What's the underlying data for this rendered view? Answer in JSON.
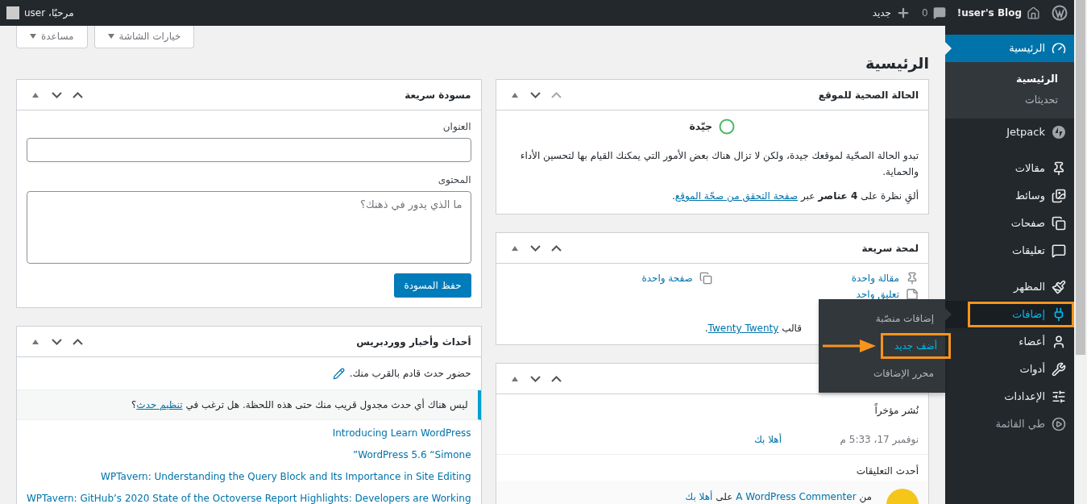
{
  "admin_bar": {
    "site_name": "user's Blog!",
    "comments_count": "0",
    "new_label": "جديد",
    "greeting": "مرحبًا، user"
  },
  "sidebar": {
    "items": [
      {
        "kind": "dashboard",
        "label": "الرئيسية",
        "selected": true,
        "hovered": false,
        "highlighted": false,
        "children": [
          {
            "label": "الرئيسية",
            "selected": true
          },
          {
            "label": "تحديثات",
            "selected": false
          }
        ]
      },
      {
        "kind": "jetpack",
        "label": "Jetpack",
        "selected": false,
        "hovered": false,
        "highlighted": false
      },
      {
        "kind": "separator"
      },
      {
        "kind": "posts",
        "label": "مقالات",
        "selected": false,
        "hovered": false,
        "highlighted": false
      },
      {
        "kind": "media",
        "label": "وسائط",
        "selected": false,
        "hovered": false,
        "highlighted": false
      },
      {
        "kind": "pages",
        "label": "صفحات",
        "selected": false,
        "hovered": false,
        "highlighted": false
      },
      {
        "kind": "comments",
        "label": "تعليقات",
        "selected": false,
        "hovered": false,
        "highlighted": false
      },
      {
        "kind": "separator"
      },
      {
        "kind": "appearance",
        "label": "المظهر",
        "selected": false,
        "hovered": false,
        "highlighted": false
      },
      {
        "kind": "plugins",
        "label": "إضافات",
        "selected": false,
        "hovered": true,
        "highlighted": true,
        "flyout": [
          {
            "label": "إضافات منصّبة",
            "selected": false,
            "highlighted": false
          },
          {
            "label": "أضف جديد",
            "selected": true,
            "highlighted": true
          },
          {
            "label": "محرر الإضافات",
            "selected": false,
            "highlighted": false
          }
        ]
      },
      {
        "kind": "users",
        "label": "أعضاء",
        "selected": false,
        "hovered": false,
        "highlighted": false
      },
      {
        "kind": "tools",
        "label": "أدوات",
        "selected": false,
        "hovered": false,
        "highlighted": false
      },
      {
        "kind": "settings",
        "label": "الإعدادات",
        "selected": false,
        "hovered": false,
        "highlighted": false
      },
      {
        "kind": "collapse",
        "label": "طي القائمة",
        "selected": false,
        "hovered": false,
        "highlighted": false
      }
    ]
  },
  "screen_meta": {
    "buttons": [
      "خيارات الشاشة",
      "مساعدة"
    ]
  },
  "page_title": "الرئيسية",
  "site_health": {
    "title": "الحالة الصحية للموقع",
    "up_disabled": true,
    "status": "جيّدة",
    "description": "تبدو الحالة الصحّية لموقعك جيدة، ولكن لا تزال هناك بعض الأمور التي يمكنك القيام بها لتحسين الأداء والحماية.",
    "details": {
      "before": "ألقِ نظرة على **4 عناصر** عبر ",
      "link": "صفحة التحقق من صحّة الموقع",
      "after": "."
    }
  },
  "at_a_glance": {
    "title": "لمحة سريعة",
    "up_disabled": false,
    "items": [
      {
        "kind": "post",
        "label": "مقالة واحدة"
      },
      {
        "kind": "page",
        "label": "صفحة واحدة"
      },
      {
        "kind": "comment",
        "label": "تعليق واحد"
      }
    ],
    "theme_line": {
      "before": "قالب ",
      "link": "Twenty Twenty",
      "after": "."
    }
  },
  "activity": {
    "up_disabled": false,
    "recently_published": {
      "heading": "نُشر مؤخراً",
      "items": [
        {
          "date": "نوفمبر 17، 5:33 م",
          "title": "أهلا بك"
        }
      ]
    },
    "recent_comments": {
      "heading": "أحدث التعليقات",
      "items": [
        {
          "from": "من",
          "author": "A WordPress Commenter",
          "on": "على",
          "post": "أهلا بك"
        }
      ]
    }
  },
  "quick_draft": {
    "title": "مسودة سريعة",
    "up_disabled": false,
    "title_label": "العنوان",
    "content_label": "المحتوى",
    "content_placeholder": "ما الذي يدور في ذهنك؟",
    "button": "حفظ المسودة"
  },
  "events": {
    "title": "أحداث وأخبار ووردبريس",
    "up_disabled": false,
    "attend": "حضور حدث قادم بالقرب منك.",
    "notice": {
      "before": "ليس هناك أي حدث مجدول قريب منك حتى هذه اللحظة. هل ترغب في ",
      "link": "تنظيم حدث",
      "after": "؟"
    },
    "news": [
      "Introducing Learn WordPress",
      "WordPress 5.6 “Simone”",
      "WPTavern: Understanding the Query Block and Its Importance in Site Editing",
      "WPTavern: GitHub’s 2020 State of the Octoverse Report Highlights: Developers are Working"
    ]
  }
}
